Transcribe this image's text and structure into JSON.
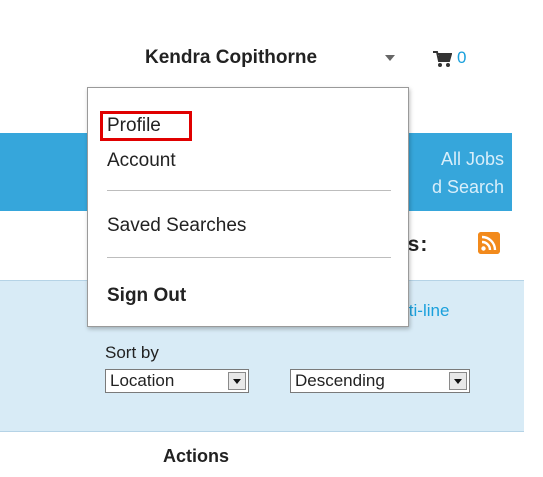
{
  "header": {
    "user_name": "Kendra Copithorne",
    "cart_count": "0",
    "icons": {
      "caret": "chevron-down-icon",
      "cart": "cart-icon"
    }
  },
  "nav": {
    "link_1": "All Jobs",
    "link_2": "d Search",
    "band_color": "#36a6db"
  },
  "rss": {
    "label": "ss:",
    "icon": "rss-icon"
  },
  "filters": {
    "multiline_link": "lti-line",
    "sort_by_label": "Sort by",
    "sort_field": "Location",
    "sort_order": "Descending",
    "panel_color": "#d8ebf6"
  },
  "actions_heading": "Actions",
  "user_menu": {
    "items": [
      {
        "label": "Profile",
        "highlighted": true
      },
      {
        "label": "Account"
      },
      {
        "label": "Saved Searches"
      },
      {
        "label": "Sign Out"
      }
    ],
    "highlight_color": "#e00000"
  }
}
